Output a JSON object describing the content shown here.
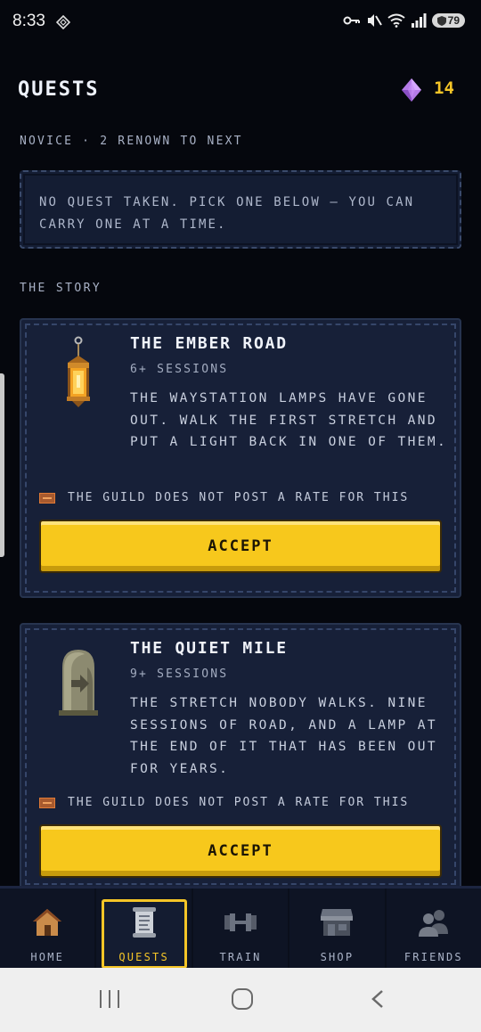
{
  "status": {
    "time": "8:33",
    "battery": "79"
  },
  "header": {
    "title": "QUESTS",
    "gems": "14",
    "gem_color": "#b57be8"
  },
  "rank": "NOVICE · 2 RENOWN TO NEXT",
  "notice": "NO QUEST TAKEN. PICK ONE BELOW — YOU CAN CARRY ONE AT A TIME.",
  "section_title": "THE STORY",
  "quests": [
    {
      "title": "THE EMBER ROAD",
      "sessions": "6+ SESSIONS",
      "description": "THE WAYSTATION LAMPS HAVE GONE OUT. WALK THE FIRST STRETCH AND PUT A LIGHT BACK IN ONE OF THEM.",
      "rate": "THE GUILD DOES NOT POST A RATE FOR THIS",
      "button": "ACCEPT",
      "icon": "lantern-icon"
    },
    {
      "title": "THE QUIET MILE",
      "sessions": "9+ SESSIONS",
      "description": "THE STRETCH NOBODY WALKS. NINE SESSIONS OF ROAD, AND A LAMP AT THE END OF IT THAT HAS BEEN OUT FOR YEARS.",
      "rate": "THE GUILD DOES NOT POST A RATE FOR THIS",
      "button": "ACCEPT",
      "icon": "milestone-icon"
    }
  ],
  "tabs": [
    {
      "label": "HOME",
      "icon": "house-icon"
    },
    {
      "label": "QUESTS",
      "icon": "scroll-icon",
      "active": true
    },
    {
      "label": "TRAIN",
      "icon": "dumbbell-icon"
    },
    {
      "label": "SHOP",
      "icon": "shop-icon"
    },
    {
      "label": "FRIENDS",
      "icon": "friends-icon"
    }
  ],
  "colors": {
    "accent": "#f5c527",
    "button": "#f7c81c",
    "background": "#05070d",
    "card": "#172038"
  }
}
